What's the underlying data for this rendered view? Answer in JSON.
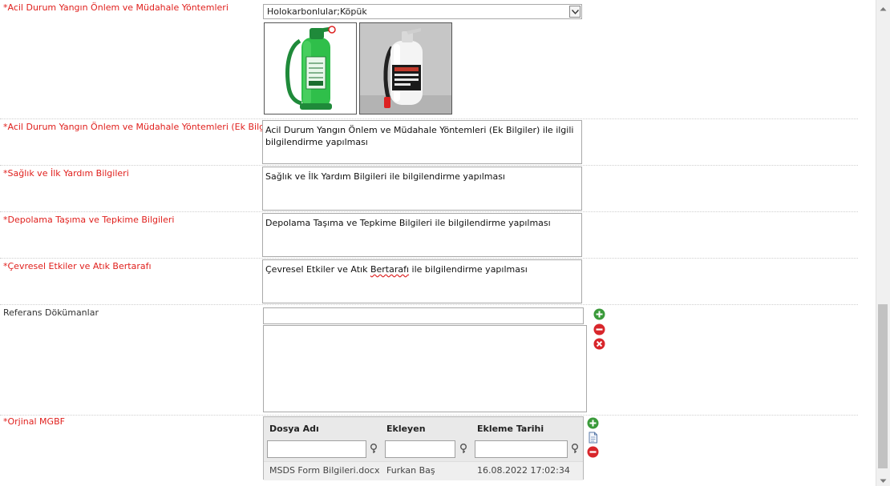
{
  "fields": {
    "fire": {
      "label": "*Acil Durum Yangın Önlem ve Müdahale Yöntemleri",
      "selected": "Holokarbonlular;Köpük"
    },
    "fire_extra": {
      "label": "*Acil Durum Yangın Önlem ve Müdahale Yöntemleri (Ek Bilgiler)",
      "line1": "Acil Durum Yangın Önlem ve Müdahale Yöntemleri (Ek Bilgiler) ile ilgili",
      "line2": "bilgilendirme yapılması"
    },
    "health": {
      "label": "*Sağlık ve İlk Yardım Bilgileri",
      "value": "Sağlık ve İlk Yardım Bilgileri ile bilgilendirme yapılması"
    },
    "storage": {
      "label": "*Depolama Taşıma ve Tepkime Bilgileri",
      "value": "Depolama Taşıma ve Tepkime Bilgileri ile bilgilendirme yapılması"
    },
    "env": {
      "label": "*Çevresel Etkiler ve Atık Bertarafı",
      "pre": "Çevresel Etkiler ve Atık ",
      "misspelled": "Bertarafı",
      "post": " ile bilgilendirme yapılması"
    },
    "refs": {
      "label": "Referans Dökümanlar"
    },
    "original": {
      "label": "*Orjinal MGBF",
      "columns": [
        "Dosya Adı",
        "Ekleyen",
        "Ekleme Tarihi"
      ],
      "rows": [
        {
          "file": "MSDS Form Bilgileri.docx",
          "added_by": "Furkan Baş",
          "date": "16.08.2022 17:02:34"
        }
      ]
    }
  },
  "colors": {
    "required_label": "#e0201d",
    "add": "#3a9a3a",
    "remove": "#d8262b"
  },
  "icons": [
    "chevron-down-icon",
    "fire-extinguisher-green",
    "fire-extinguisher-white",
    "plus-circle-icon",
    "minus-circle-icon",
    "close-circle-icon",
    "filter-key-icon",
    "document-icon"
  ]
}
